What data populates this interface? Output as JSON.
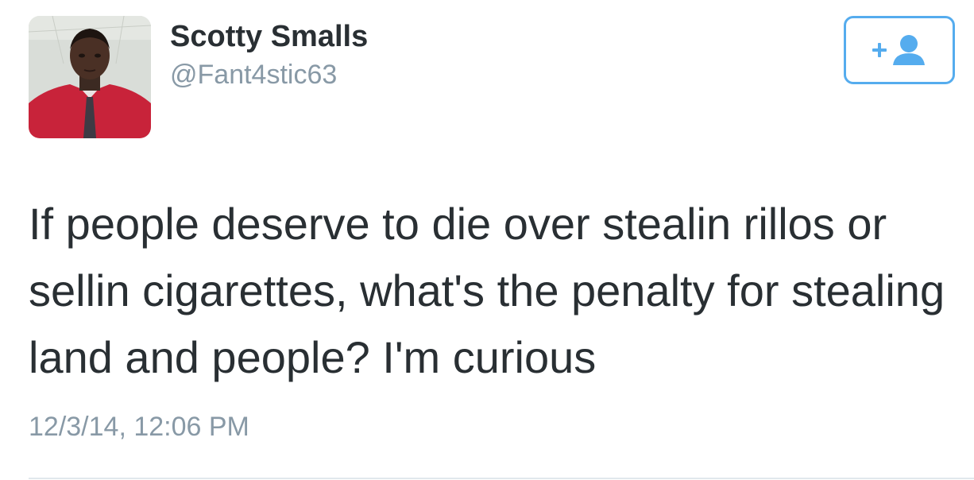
{
  "tweet": {
    "author": {
      "display_name": "Scotty Smalls",
      "handle": "@Fant4stic63",
      "avatar_icon": "profile-photo"
    },
    "follow_button": {
      "icon": "add-user-icon",
      "label": "+"
    },
    "text": "If people deserve to die over stealin rillos or sellin cigarettes, what's the penalty for stealing land and people? I'm curious",
    "timestamp": "12/3/14, 12:06 PM"
  },
  "colors": {
    "name": "#292f33",
    "secondary_text": "#8899a6",
    "accent": "#55acee",
    "divider": "#e1e8ed"
  }
}
